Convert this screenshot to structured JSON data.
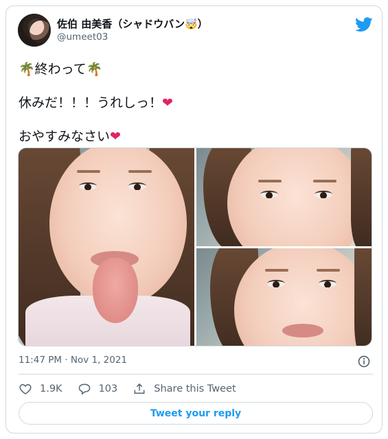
{
  "tweet": {
    "author": {
      "display_name": "佐伯 由美香（シャドウバン🤯）",
      "username": "@umeet03"
    },
    "lines": [
      "🌴終わって🌴",
      "休みだ！！！うれしっ！❤",
      "おやすみなさい❤"
    ],
    "timestamp": "11:47 PM · Nov 1, 2021",
    "media_count": 3
  },
  "actions": {
    "likes": "1.9K",
    "replies": "103",
    "share_label": "Share this Tweet"
  },
  "reply_button": {
    "label": "Tweet your reply"
  },
  "colors": {
    "brand": "#1d9bf0",
    "text": "#0f1419",
    "muted": "#536471",
    "border": "#cfd9de"
  },
  "icons": [
    "twitter-bird-icon",
    "info-icon",
    "heart-icon",
    "reply-bubble-icon",
    "share-icon"
  ]
}
